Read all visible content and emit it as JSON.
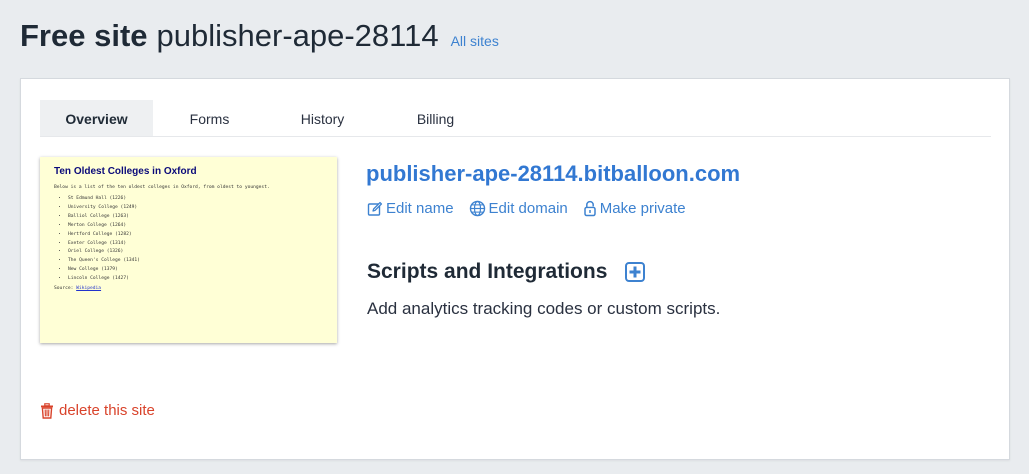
{
  "header": {
    "title_bold": "Free site",
    "site_name": "publisher-ape-28114",
    "all_sites_link": "All sites"
  },
  "tabs": [
    {
      "label": "Overview",
      "active": true
    },
    {
      "label": "Forms",
      "active": false
    },
    {
      "label": "History",
      "active": false
    },
    {
      "label": "Billing",
      "active": false
    }
  ],
  "preview": {
    "title": "Ten Oldest Colleges in Oxford",
    "intro": "Below is a list of the ten oldest colleges in Oxford, from oldest to youngest.",
    "items": [
      "St Edmund Hall (1226)",
      "University College (1249)",
      "Balliol College (1263)",
      "Merton College (1264)",
      "Hertford College (1282)",
      "Exeter College (1314)",
      "Oriel College (1326)",
      "The Queen's College (1341)",
      "New College (1379)",
      "Lincoln College (1427)"
    ],
    "source_label": "Source:",
    "source_link": "Wikipedia"
  },
  "site": {
    "url": "publisher-ape-28114.bitballoon.com",
    "edit_name": "Edit name",
    "edit_domain": "Edit domain",
    "make_private": "Make private"
  },
  "scripts": {
    "title": "Scripts and Integrations",
    "description": "Add analytics tracking codes or custom scripts."
  },
  "delete_label": "delete this site",
  "colors": {
    "background": "#e9ecef",
    "link": "#3d82d0",
    "site_url": "#3278d2",
    "danger": "#d9432b",
    "preview_bg": "#ffffd6"
  }
}
